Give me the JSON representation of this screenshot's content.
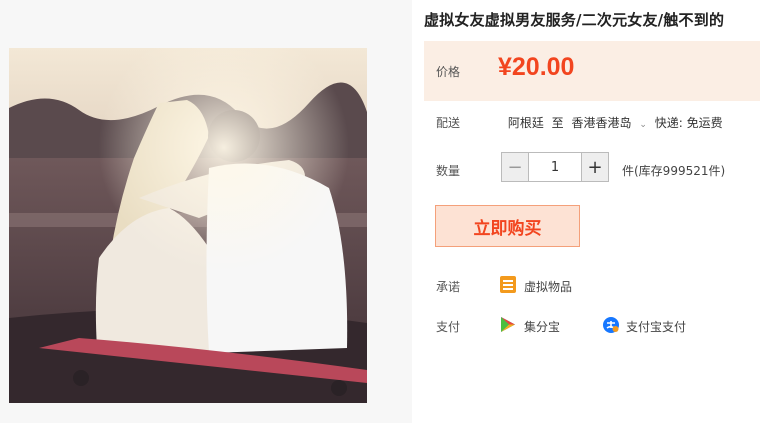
{
  "product": {
    "title": "虚拟女友虚拟男友服务/二次元女友/触不到的"
  },
  "price": {
    "label": "价格",
    "value": "¥20.00",
    "color": "#f2451f"
  },
  "delivery": {
    "label": "配送",
    "from": "阿根廷",
    "to_word": "至",
    "destination": "香港香港岛",
    "express": "快递: 免运费"
  },
  "quantity": {
    "label": "数量",
    "minus": "−",
    "value": "1",
    "plus": "+",
    "stock_text": "件(库存999521件)"
  },
  "buy_button": {
    "label": "立即购买"
  },
  "promise": {
    "label": "承诺",
    "text": "虚拟物品",
    "icon": "virtual-goods-icon"
  },
  "payment": {
    "label": "支付",
    "options": [
      {
        "label": "集分宝",
        "icon": "jifenbao-icon"
      },
      {
        "label": "支付宝支付",
        "icon": "alipay-icon"
      }
    ]
  }
}
